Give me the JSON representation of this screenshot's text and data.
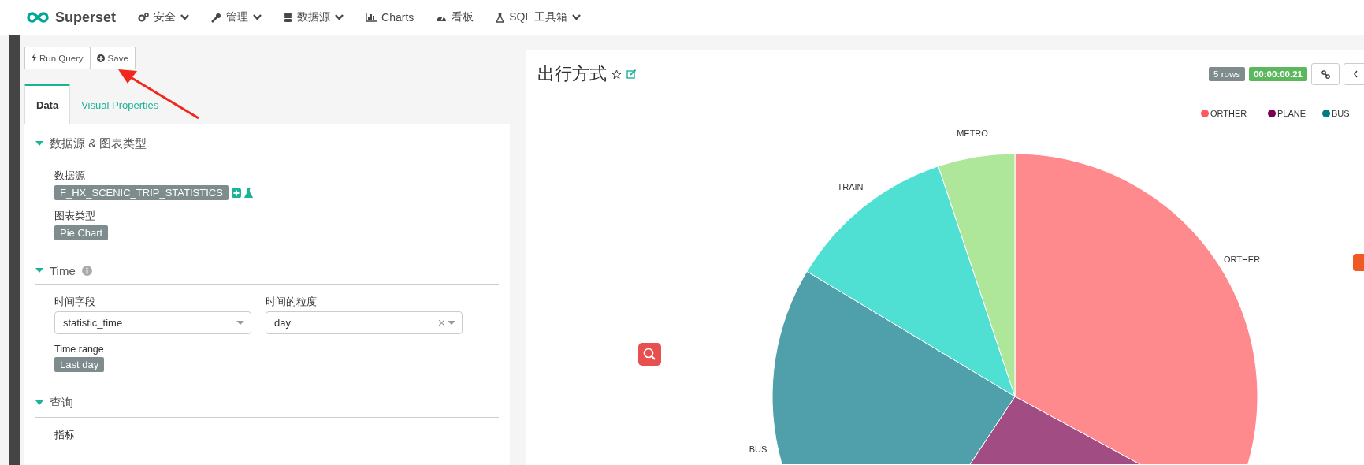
{
  "nav": {
    "brand": "Superset",
    "items": [
      {
        "label": "安全",
        "dropdown": true
      },
      {
        "label": "管理",
        "dropdown": true
      },
      {
        "label": "数据源",
        "dropdown": true
      },
      {
        "label": "Charts",
        "dropdown": false
      },
      {
        "label": "看板",
        "dropdown": false
      },
      {
        "label": "SQL 工具箱",
        "dropdown": true
      }
    ]
  },
  "toolbar": {
    "buttons": [
      {
        "label": "Run Query"
      },
      {
        "label": "Save"
      }
    ]
  },
  "tabs": [
    {
      "label": "Data",
      "selected": true
    },
    {
      "label": "Visual Properties",
      "selected": false
    }
  ],
  "sections": [
    {
      "title": "数据源 & 图表类型",
      "expanded": true,
      "info": false,
      "fields": [
        {
          "kind": "tag",
          "label": "数据源",
          "value": "F_HX_SCENIC_TRIP_STATISTICS",
          "actions": true
        },
        {
          "kind": "tag",
          "label": "图表类型",
          "value": "Pie Chart",
          "actions": false
        }
      ]
    },
    {
      "title": "Time",
      "expanded": true,
      "info": true,
      "fields": [
        {
          "kind": "selects",
          "items": [
            {
              "label": "时间字段",
              "value": "statistic_time",
              "clearable": false
            },
            {
              "label": "时间的粒度",
              "value": "day",
              "clearable": true
            }
          ]
        },
        {
          "kind": "tag",
          "label": "Time range",
          "value": "Last day",
          "actions": false
        }
      ]
    },
    {
      "title": "查询",
      "expanded": true,
      "info": false,
      "fields": [
        {
          "kind": "label",
          "label": "指标"
        }
      ]
    }
  ],
  "chart": {
    "title": "出行方式",
    "rows": "5 rows",
    "duration": "00:00:00.21",
    "legend": [
      {
        "label": "ORTHER",
        "color": "#ff5a5f"
      },
      {
        "label": "PLANE",
        "color": "#7b0051"
      },
      {
        "label": "BUS",
        "color": "#007a87"
      }
    ],
    "slices": [
      {
        "label": "ORTHER",
        "color": "#ff8a8e"
      },
      {
        "color": "#a14d83"
      },
      {
        "label": "BUS",
        "color": "#4fa0aa"
      },
      {
        "label": "TRAIN",
        "color": "#4fe0d3"
      },
      {
        "label": "METRO",
        "color": "#afe79a"
      }
    ]
  }
}
